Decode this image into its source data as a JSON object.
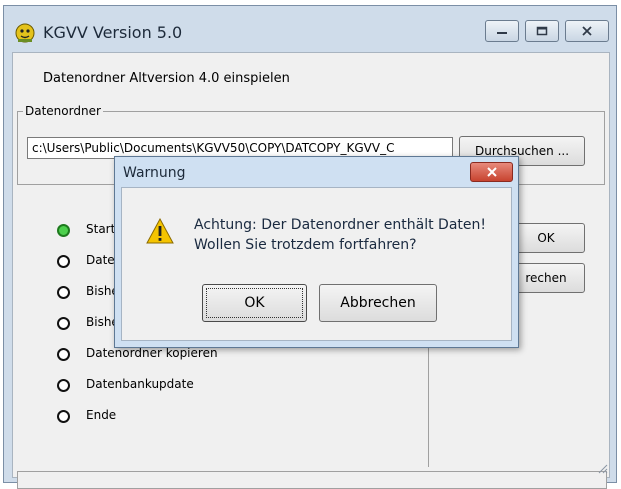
{
  "window": {
    "title": "KGVV Version 5.0",
    "subtitle": "Datenordner Altversion 4.0 einspielen"
  },
  "folder_group": {
    "label": "Datenordner",
    "path_value": "c:\\Users\\Public\\Documents\\KGVV50\\COPY\\DATCOPY_KGVV_C",
    "browse_label": "Durchsuchen ..."
  },
  "steps": [
    {
      "label": "Start",
      "status": "active"
    },
    {
      "label": "Date",
      "status": "pending"
    },
    {
      "label": "Bishe",
      "status": "pending"
    },
    {
      "label": "Bishe",
      "status": "pending"
    },
    {
      "label": "Datenordner kopieren",
      "status": "pending"
    },
    {
      "label": "Datenbankupdate",
      "status": "pending"
    },
    {
      "label": "Ende",
      "status": "pending"
    }
  ],
  "main_buttons": {
    "ok": "OK",
    "cancel": "rechen"
  },
  "dialog": {
    "title": "Warnung",
    "icon": "warning-icon",
    "message_line1": "Achtung: Der Datenordner enthält Daten!",
    "message_line2": "Wollen Sie trotzdem fortfahren?",
    "ok_label": "OK",
    "cancel_label": "Abbrechen"
  },
  "colors": {
    "active_step": "#4cd04c",
    "dialog_close": "#c7432f",
    "warning_yellow": "#f5c400"
  }
}
